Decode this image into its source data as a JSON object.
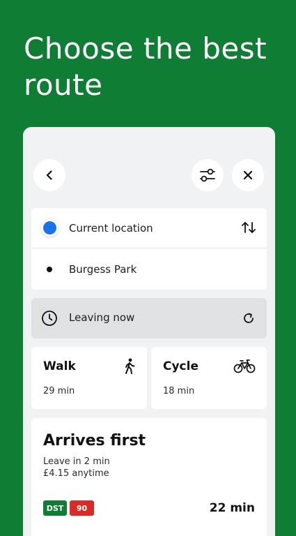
{
  "headline": "Choose the best route",
  "colors": {
    "background": "#0f7d34",
    "panel": "#f1f2f4",
    "location_dot": "#1a73e8",
    "badge_dst": "#0f7d34",
    "badge_bus": "#d92b26"
  },
  "toolbar": {
    "back_icon": "chevron-left-icon",
    "filter_icon": "sliders-icon",
    "close_icon": "close-icon"
  },
  "locations": {
    "from": "Current location",
    "to": "Burgess Park",
    "swap_icon": "swap-vertical-icon"
  },
  "departure": {
    "label": "Leaving now",
    "clock_icon": "clock-icon",
    "refresh_icon": "refresh-icon"
  },
  "modes": [
    {
      "name": "Walk",
      "time": "29 min",
      "icon": "walking-person-icon"
    },
    {
      "name": "Cycle",
      "time": "18 min",
      "icon": "bicycle-icon"
    }
  ],
  "route": {
    "title": "Arrives first",
    "leave": "Leave in 2 min",
    "fare": "£4.15 anytime",
    "badges": [
      "DST",
      "90"
    ],
    "duration": "22 min"
  }
}
